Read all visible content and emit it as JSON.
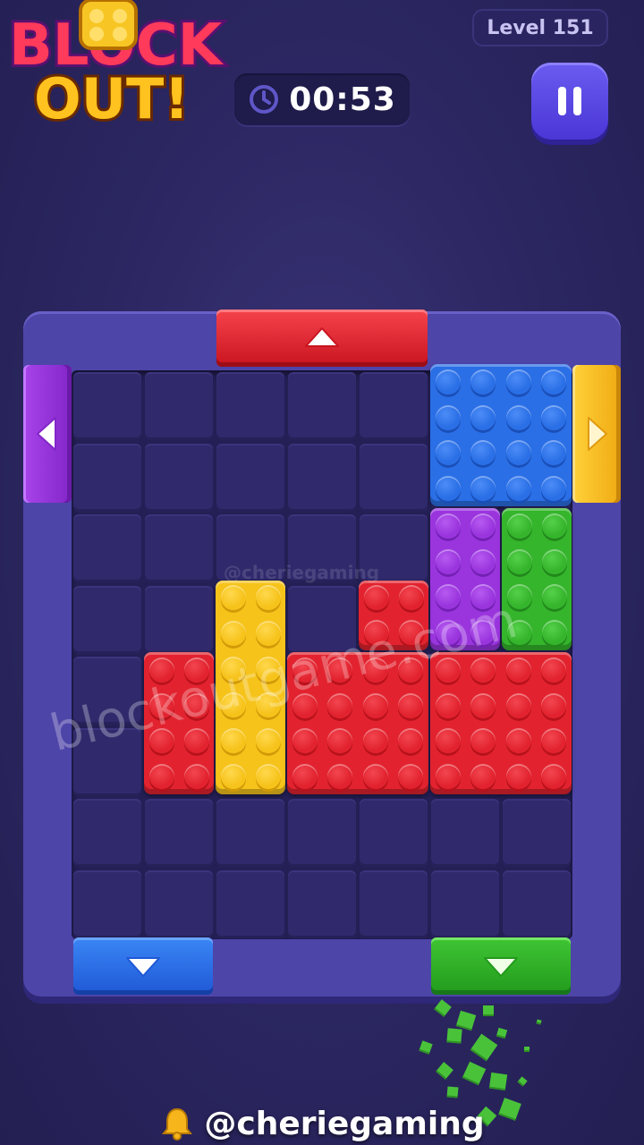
{
  "logo": {
    "line1": "BLOCK",
    "line2": "OUT!"
  },
  "header": {
    "level_label": "Level 151",
    "timer": "00:53"
  },
  "watermarks": {
    "site": "blockoutgame.com",
    "handle": "@cheriegaming"
  },
  "footer": {
    "handle": "@cheriegaming"
  },
  "board": {
    "cols": 7,
    "rows": 8
  },
  "colors": {
    "red": "#e2232f",
    "yellow": "#f6c31b",
    "blue": "#2a6fe6",
    "purple": "#9a35de",
    "green": "#35b52c",
    "frame": "#4e45a8"
  },
  "gates": [
    {
      "name": "gate-top-red",
      "color": "red",
      "arrow": "up"
    },
    {
      "name": "gate-left-purple",
      "color": "purple",
      "arrow": "left"
    },
    {
      "name": "gate-right-yellow",
      "color": "yellow",
      "arrow": "right"
    },
    {
      "name": "gate-bottom-blue",
      "color": "blue",
      "arrow": "down"
    },
    {
      "name": "gate-bottom-green",
      "color": "green",
      "arrow": "down"
    }
  ],
  "blocks": [
    {
      "name": "block-blue",
      "color": "blue",
      "col": 5,
      "row": 0,
      "w": 2,
      "h": 2
    },
    {
      "name": "block-purple",
      "color": "purple",
      "col": 5,
      "row": 2,
      "w": 1,
      "h": 2
    },
    {
      "name": "block-green",
      "color": "green",
      "col": 6,
      "row": 2,
      "w": 1,
      "h": 2
    },
    {
      "name": "block-yellow",
      "color": "yellow",
      "col": 2,
      "row": 3,
      "w": 1,
      "h": 3
    },
    {
      "name": "block-red-small",
      "color": "red",
      "col": 4,
      "row": 3,
      "w": 1,
      "h": 1
    },
    {
      "name": "block-red-left",
      "color": "red",
      "col": 1,
      "row": 4,
      "w": 1,
      "h": 2
    },
    {
      "name": "block-red-middle",
      "color": "red",
      "col": 3,
      "row": 4,
      "w": 2,
      "h": 2
    },
    {
      "name": "block-red-right",
      "color": "red",
      "col": 5,
      "row": 4,
      "w": 2,
      "h": 2
    }
  ]
}
